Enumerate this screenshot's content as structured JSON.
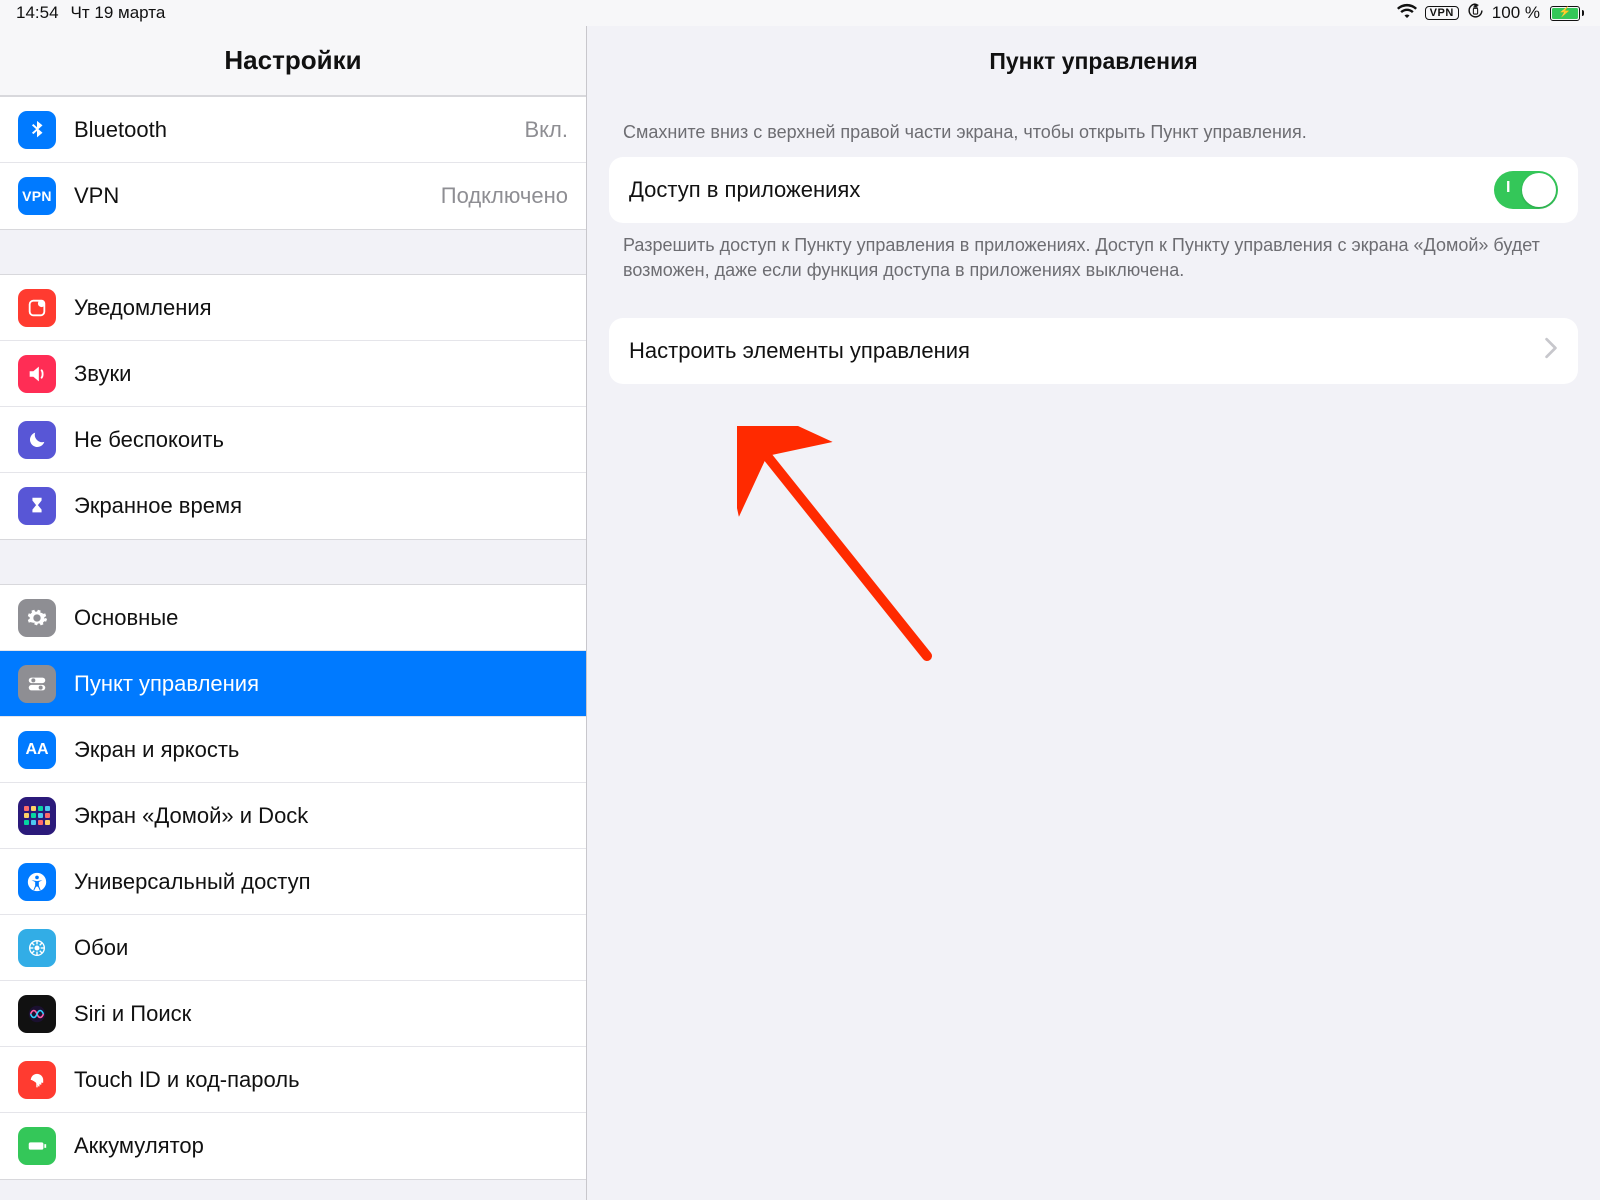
{
  "status": {
    "time": "14:54",
    "date": "Чт 19 марта",
    "vpn_label": "VPN",
    "battery_text": "100 %"
  },
  "sidebar": {
    "title": "Настройки",
    "groups": [
      {
        "items": [
          {
            "key": "bluetooth",
            "label": "Bluetooth",
            "value": "Вкл."
          },
          {
            "key": "vpn",
            "label": "VPN",
            "value": "Подключено"
          }
        ]
      },
      {
        "items": [
          {
            "key": "notifications",
            "label": "Уведомления"
          },
          {
            "key": "sounds",
            "label": "Звуки"
          },
          {
            "key": "do-not-disturb",
            "label": "Не беспокоить"
          },
          {
            "key": "screen-time",
            "label": "Экранное время"
          }
        ]
      },
      {
        "items": [
          {
            "key": "general",
            "label": "Основные"
          },
          {
            "key": "control-center",
            "label": "Пункт управления",
            "selected": true
          },
          {
            "key": "display",
            "label": "Экран и яркость"
          },
          {
            "key": "home-dock",
            "label": "Экран «Домой» и Dock"
          },
          {
            "key": "accessibility",
            "label": "Универсальный доступ"
          },
          {
            "key": "wallpaper",
            "label": "Обои"
          },
          {
            "key": "siri",
            "label": "Siri и Поиск"
          },
          {
            "key": "touch-id",
            "label": "Touch ID и код-пароль"
          },
          {
            "key": "battery",
            "label": "Аккумулятор"
          }
        ]
      }
    ]
  },
  "detail": {
    "title": "Пункт управления",
    "hint_top": "Смахните вниз с верхней правой части экрана, чтобы открыть Пункт управления.",
    "toggle_row_label": "Доступ в приложениях",
    "toggle_on": true,
    "hint_below": "Разрешить доступ к Пункту управления в приложениях. Доступ к Пункту управления с экрана «Домой» будет возможен, даже если функция доступа в приложениях выключена.",
    "customize_label": "Настроить элементы управления"
  },
  "colors": {
    "accent": "#007aff",
    "toggle_on": "#34c759",
    "annotation_arrow": "#ff2a00"
  }
}
